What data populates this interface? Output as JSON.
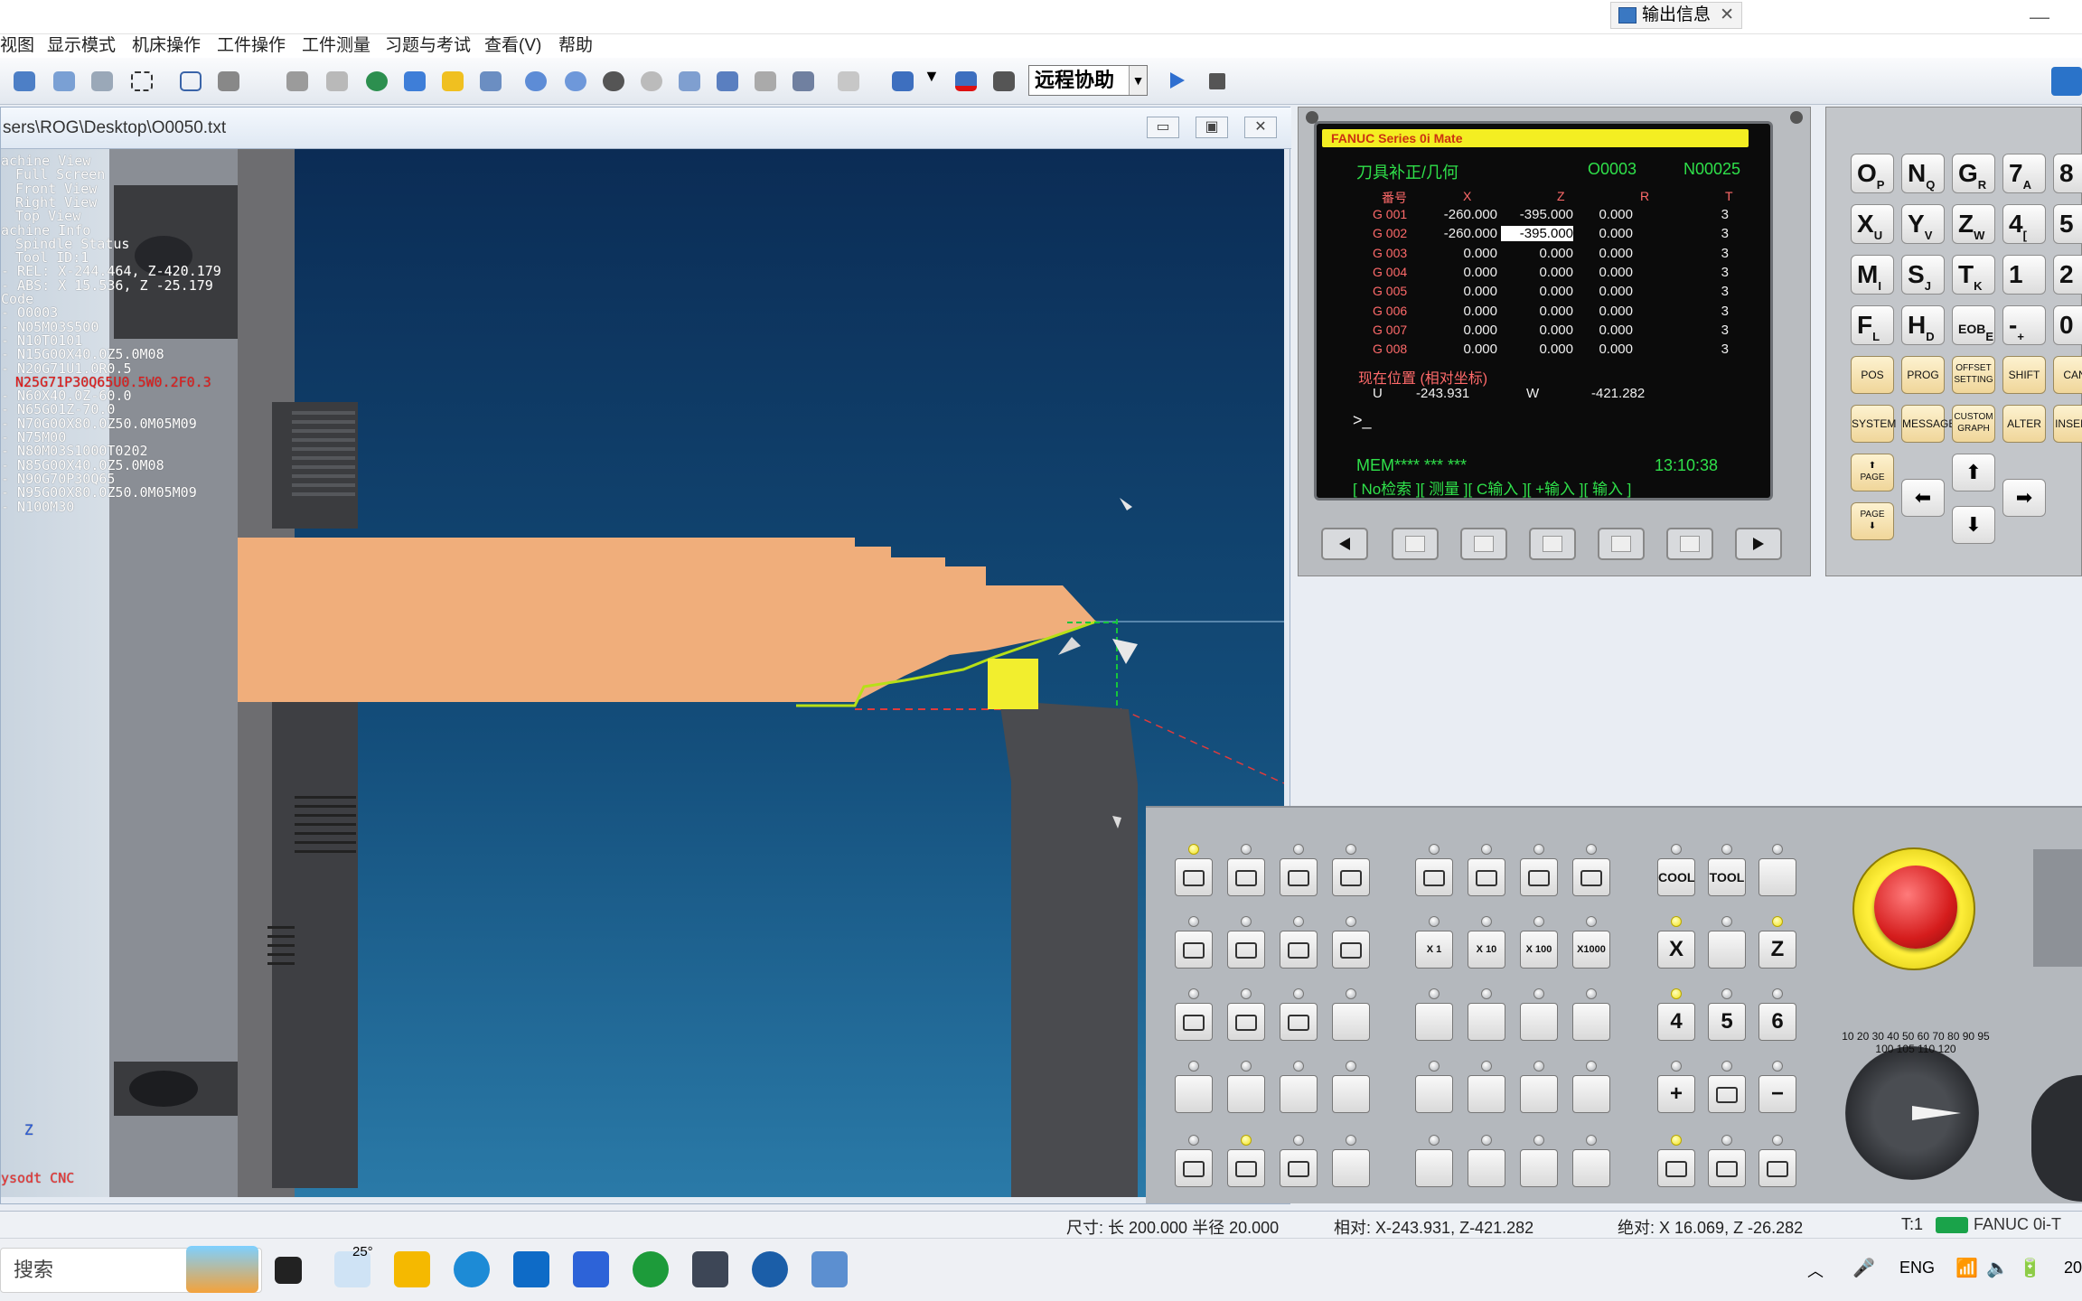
{
  "titlebar": {
    "output_tab": "输出信息"
  },
  "menu": [
    "视图",
    "显示模式",
    "机床操作",
    "工件操作",
    "工件测量",
    "习题与考试",
    "查看(V)",
    "帮助"
  ],
  "toolbar": {
    "remote_select": "远程协助"
  },
  "viewport": {
    "path": "sers\\ROG\\Desktop\\O0050.txt",
    "tree": [
      {
        "t": "achine View",
        "c": "w"
      },
      {
        "t": "Full Screen",
        "c": "w"
      },
      {
        "t": "Front View",
        "c": "w"
      },
      {
        "t": "Right View",
        "c": "w"
      },
      {
        "t": "Top View",
        "c": "w"
      },
      {
        "t": "achine Info",
        "c": "w"
      },
      {
        "t": "Spindle Status",
        "c": "w"
      },
      {
        "t": "Tool ID:1",
        "c": "w"
      },
      {
        "t": "- REL: X-244.464, Z-420.179",
        "c": "w"
      },
      {
        "t": "- ABS: X  15.536, Z -25.179",
        "c": "w"
      },
      {
        "t": " Code",
        "c": "w"
      },
      {
        "t": "- O0003",
        "c": "w"
      },
      {
        "t": "- N05M03S500",
        "c": "w"
      },
      {
        "t": "- N10T0101",
        "c": "w"
      },
      {
        "t": "- N15G00X40.0Z5.0M08",
        "c": "w"
      },
      {
        "t": "- N20G71U1.0R0.5",
        "c": "w"
      },
      {
        "t": "N25G71P30Q65U0.5W0.2F0.3",
        "c": "r"
      },
      {
        "t": "- N60X40.0Z-60.0",
        "c": "w"
      },
      {
        "t": "- N65G01Z-70.0",
        "c": "w"
      },
      {
        "t": "- N70G00X80.0Z50.0M05M09",
        "c": "w"
      },
      {
        "t": "- N75M00",
        "c": "w"
      },
      {
        "t": "- N80M03S1000T0202",
        "c": "w"
      },
      {
        "t": "- N85G00X40.0Z5.0M08",
        "c": "w"
      },
      {
        "t": "- N90G70P30Q65",
        "c": "w"
      },
      {
        "t": "- N95G00X80.0Z50.0M05M09",
        "c": "w"
      },
      {
        "t": "- N100M30",
        "c": "w"
      }
    ],
    "axis_label": "Z",
    "brand": "ysodt CNC"
  },
  "cnc": {
    "series": "FANUC Series 0i Mate",
    "screen_title": "刀具补正/几何",
    "program": "O0003",
    "seq": "N00025",
    "cols": [
      "番号",
      "X",
      "Z",
      "R",
      "T"
    ],
    "rows": [
      [
        "G 001",
        "-260.000",
        "-395.000",
        "0.000",
        "3"
      ],
      [
        "G 002",
        "-260.000",
        "-395.000",
        "0.000",
        "3"
      ],
      [
        "G 003",
        "0.000",
        "0.000",
        "0.000",
        "3"
      ],
      [
        "G 004",
        "0.000",
        "0.000",
        "0.000",
        "3"
      ],
      [
        "G 005",
        "0.000",
        "0.000",
        "0.000",
        "3"
      ],
      [
        "G 006",
        "0.000",
        "0.000",
        "0.000",
        "3"
      ],
      [
        "G 007",
        "0.000",
        "0.000",
        "0.000",
        "3"
      ],
      [
        "G 008",
        "0.000",
        "0.000",
        "0.000",
        "3"
      ]
    ],
    "pos_label": "现在位置 (相对坐标)",
    "u_label": "U",
    "u_value": "-243.931",
    "w_label": "W",
    "w_value": "-421.282",
    "prompt": ">_",
    "mode": "MEM**** ***    ***",
    "time": "13:10:38",
    "softkeys": "[ No检索 ][  测量  ][ C输入 ][ +输入 ][  输入  ]"
  },
  "keypad": {
    "keys": [
      [
        "O",
        "P"
      ],
      [
        "N",
        "Q"
      ],
      [
        "G",
        "R"
      ],
      [
        "7",
        "A"
      ],
      [
        "8",
        ""
      ],
      [
        "X",
        "U"
      ],
      [
        "Y",
        "V"
      ],
      [
        "Z",
        "W"
      ],
      [
        "4",
        "["
      ],
      [
        "5",
        ""
      ],
      [
        "M",
        "I"
      ],
      [
        "S",
        "J"
      ],
      [
        "T",
        "K"
      ],
      [
        "1",
        ""
      ],
      [
        "2",
        ""
      ],
      [
        "F",
        "L"
      ],
      [
        "H",
        "D"
      ],
      [
        "EOB",
        "E"
      ],
      [
        "-",
        "+"
      ],
      [
        "0",
        ""
      ]
    ],
    "fkeys": [
      "POS",
      "PROG",
      "OFFSET SETTING",
      "SHIFT",
      "CAN",
      "SYSTEM",
      "MESSAGE",
      "CUSTOM GRAPH",
      "ALTER",
      "INSERT"
    ],
    "page_up": "PAGE",
    "page_down": "PAGE"
  },
  "panel": {
    "cool": "COOL",
    "tool": "TOOL",
    "step1": "X  1",
    "step10": "X 10",
    "step100": "X 100",
    "step1000": "X1000",
    "axis_x": "X",
    "axis_z": "Z",
    "n4": "4",
    "n5": "5",
    "n6": "6",
    "plus": "+",
    "minus": "−",
    "dial_ticks": "10 20 30 40 50 60 70 80 90 95 100 105 110 120"
  },
  "status": {
    "size": "尺寸: 长 200.000 半径  20.000",
    "rel": "相对: X-243.931, Z-421.282",
    "abs": "绝对: X  16.069, Z -26.282",
    "tool": "T:1",
    "machine": "FANUC 0i-T"
  },
  "taskbar": {
    "search": "搜索",
    "weather": "25°",
    "lang": "ENG",
    "clock_partial": "20"
  }
}
